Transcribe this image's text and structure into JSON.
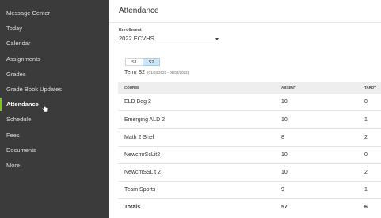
{
  "nav": [
    {
      "label": "Message Center",
      "active": false
    },
    {
      "label": "Today",
      "active": false
    },
    {
      "label": "Calendar",
      "active": false
    },
    {
      "label": "Assignments",
      "active": false
    },
    {
      "label": "Grades",
      "active": false
    },
    {
      "label": "Grade Book Updates",
      "active": false
    },
    {
      "label": "Attendance",
      "active": true
    },
    {
      "label": "Schedule",
      "active": false
    },
    {
      "label": "Fees",
      "active": false
    },
    {
      "label": "Documents",
      "active": false
    },
    {
      "label": "More",
      "active": false
    }
  ],
  "page_title": "Attendance",
  "enrollment": {
    "label": "Enrollment",
    "selected": "2022 ECVHS"
  },
  "terms": {
    "buttons": [
      "S1",
      "S2"
    ],
    "selected": "S2",
    "term_label": "Term S2",
    "term_dates": "(01/03/2022 - 06/02/2022)"
  },
  "table": {
    "headers": {
      "course": "COURSE",
      "absent": "ABSENT",
      "tardy": "TARDY"
    },
    "rows": [
      {
        "course": "ELD Beg 2",
        "absent": "10",
        "tardy": "0"
      },
      {
        "course": "Emerging ALD 2",
        "absent": "10",
        "tardy": "1"
      },
      {
        "course": "Math 2 Shel",
        "absent": "8",
        "tardy": "2"
      },
      {
        "course": "NewcmrScLit2",
        "absent": "10",
        "tardy": "0"
      },
      {
        "course": "NewcmSSLit 2",
        "absent": "10",
        "tardy": "2"
      },
      {
        "course": "Team Sports",
        "absent": "9",
        "tardy": "1"
      }
    ],
    "totals": {
      "label": "Totals",
      "absent": "57",
      "tardy": "6"
    }
  },
  "colors": {
    "sidebar_bg": "#3b3b3b",
    "active_accent": "#7fc31c",
    "selected_term_bg": "#cfe6f6",
    "table_header_bg": "#eeeeee"
  },
  "icons": {
    "pointer": "hand-pointer-icon",
    "dropdown": "chevron-down-icon"
  }
}
